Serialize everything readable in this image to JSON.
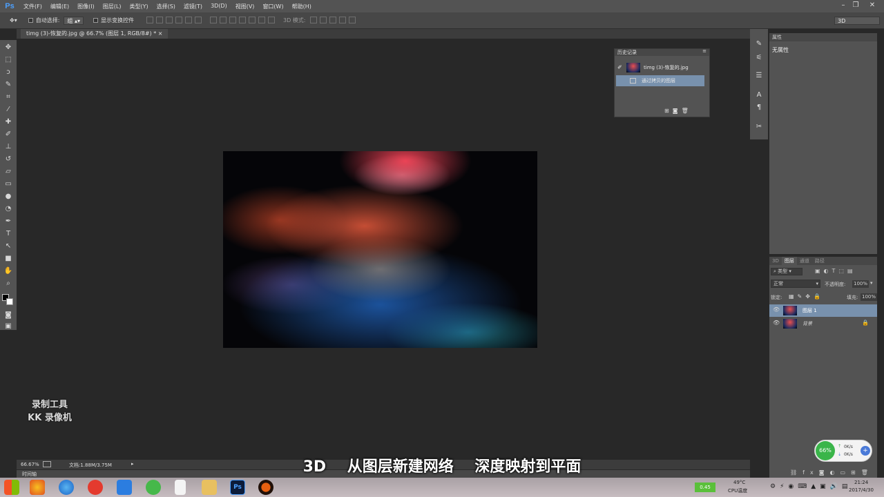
{
  "app": {
    "logo": "Ps"
  },
  "menu": [
    "文件(F)",
    "编辑(E)",
    "图像(I)",
    "图层(L)",
    "类型(Y)",
    "选择(S)",
    "滤镜(T)",
    "3D(D)",
    "视图(V)",
    "窗口(W)",
    "帮助(H)"
  ],
  "options": {
    "auto_select_label": "自动选择:",
    "auto_select_value": "组",
    "show_transform_label": "显示变换控件",
    "mode_3d_label": "3D 模式:",
    "workspace": "3D"
  },
  "document": {
    "tab_title": "timg (3)-恢复的.jpg @ 66.7% (图层 1, RGB/8#) *"
  },
  "history": {
    "title": "历史记录",
    "snapshot": "timg (3)-恢复的.jpg",
    "steps": [
      "通过拷贝的图层"
    ]
  },
  "properties": {
    "title": "属性",
    "content": "无属性"
  },
  "layers_panel": {
    "tabs": [
      "3D",
      "图层",
      "通道",
      "路径"
    ],
    "filter_label": "类型",
    "blend_mode": "正常",
    "opacity_label": "不透明度:",
    "opacity": "100%",
    "lock_label": "锁定:",
    "fill_label": "填充:",
    "fill": "100%",
    "layers": [
      {
        "name": "图层 1"
      },
      {
        "name": "背景"
      }
    ]
  },
  "status": {
    "zoom": "66.67%",
    "doc_size": "文档:1.88M/3.75M",
    "timeline": "时间轴"
  },
  "subtitle": "3D    从图层新建网络    深度映射到平面",
  "watermark": {
    "line1": "录制工具",
    "line2": "KK 录像机"
  },
  "taskbar": {
    "temp": "49°C",
    "cpu_label": "CPU温度",
    "time": "21:24",
    "date": "2017/4/30",
    "net_percent": "66%",
    "up_speed": "0K/s",
    "down_speed": "0K/s",
    "battery": "0.45"
  }
}
